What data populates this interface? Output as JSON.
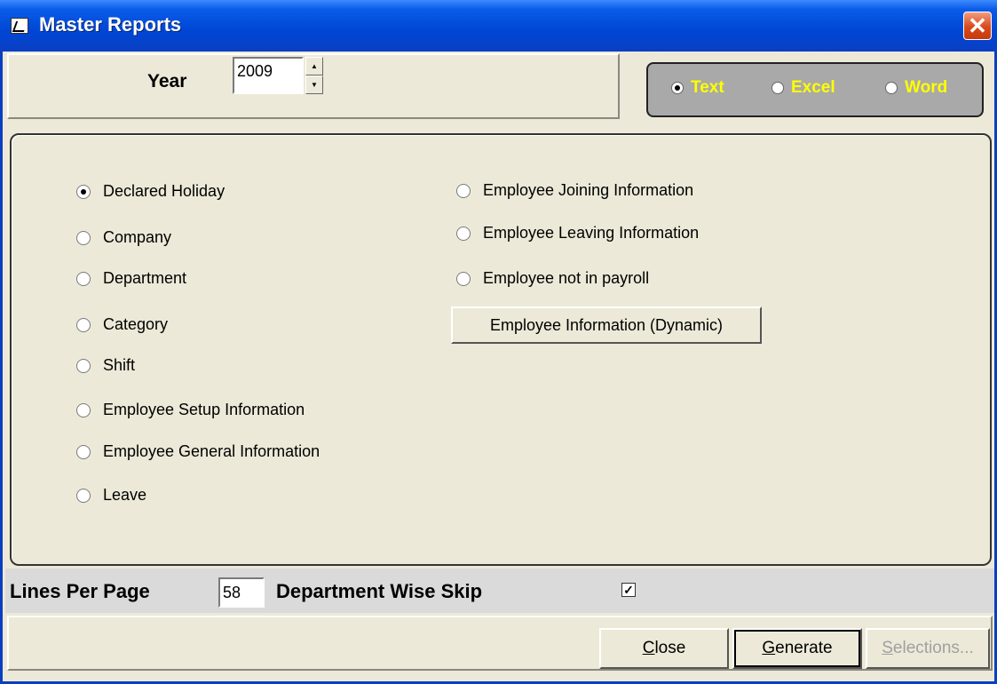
{
  "window": {
    "title": "Master Reports"
  },
  "year": {
    "label": "Year",
    "value": "2009"
  },
  "output_format": {
    "options": [
      {
        "label": "Text",
        "selected": true
      },
      {
        "label": "Excel",
        "selected": false
      },
      {
        "label": "Word",
        "selected": false
      }
    ]
  },
  "reports": {
    "left": [
      {
        "label": "Declared Holiday",
        "selected": true
      },
      {
        "label": "Company",
        "selected": false
      },
      {
        "label": "Department",
        "selected": false
      },
      {
        "label": "Category",
        "selected": false
      },
      {
        "label": "Shift",
        "selected": false
      },
      {
        "label": "Employee Setup Information",
        "selected": false
      },
      {
        "label": "Employee General Information",
        "selected": false
      },
      {
        "label": "Leave",
        "selected": false
      }
    ],
    "right": [
      {
        "label": "Employee Joining Information",
        "selected": false
      },
      {
        "label": "Employee Leaving Information",
        "selected": false
      },
      {
        "label": "Employee not in payroll",
        "selected": false
      }
    ],
    "dynamic_button": "Employee Information (Dynamic)"
  },
  "options": {
    "lines_per_page_label": "Lines Per Page",
    "lines_per_page_value": "58",
    "dept_skip_label": "Department Wise Skip",
    "dept_skip_checked": "✓"
  },
  "buttons": {
    "close_prefix": "C",
    "close_rest": "lose",
    "generate_prefix": "G",
    "generate_rest": "enerate",
    "selections_prefix": "S",
    "selections_rest": "elections..."
  }
}
